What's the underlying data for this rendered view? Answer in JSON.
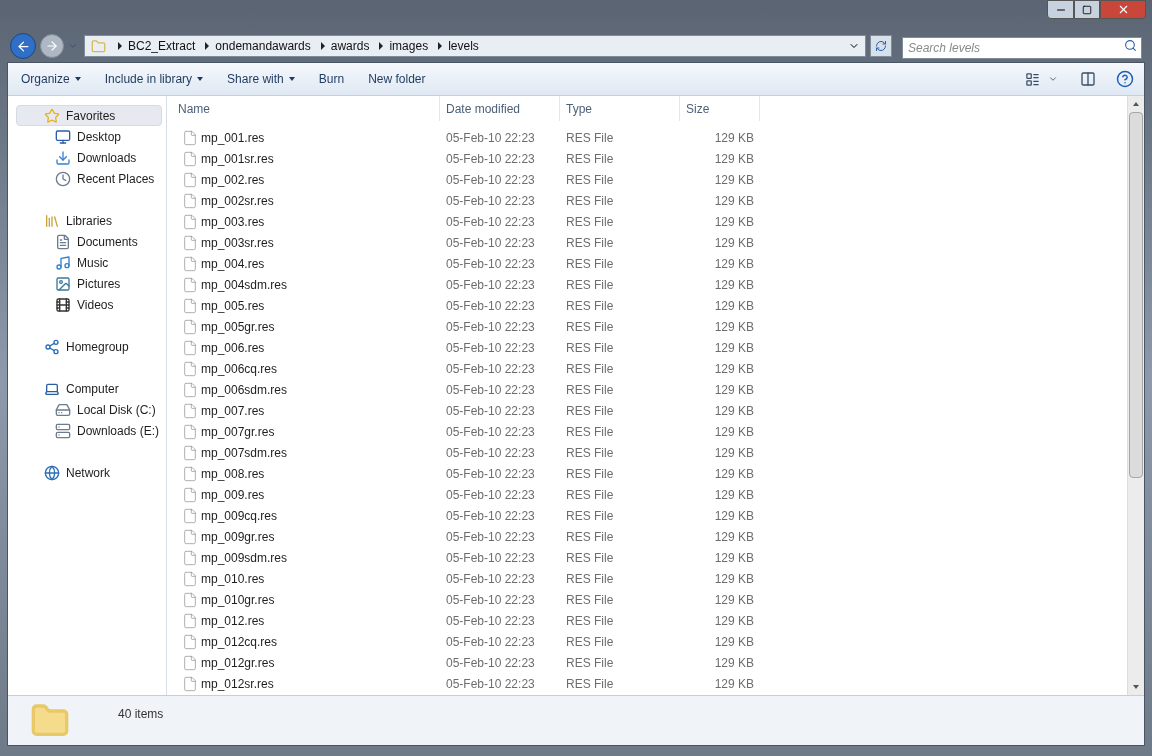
{
  "address": {
    "crumbs": [
      "BC2_Extract",
      "ondemandawards",
      "awards",
      "images",
      "levels"
    ]
  },
  "search": {
    "placeholder": "Search levels"
  },
  "toolbar": {
    "items": [
      {
        "label": "Organize",
        "dropdown": true
      },
      {
        "label": "Include in library",
        "dropdown": true
      },
      {
        "label": "Share with",
        "dropdown": true
      },
      {
        "label": "Burn",
        "dropdown": false
      },
      {
        "label": "New folder",
        "dropdown": false
      }
    ]
  },
  "sidebar": {
    "groups": [
      {
        "label": "Favorites",
        "selected": true,
        "children": [
          {
            "label": "Desktop",
            "selected": false
          },
          {
            "label": "Downloads",
            "selected": false
          },
          {
            "label": "Recent Places",
            "selected": false
          }
        ]
      },
      {
        "label": "Libraries",
        "selected": false,
        "children": [
          {
            "label": "Documents",
            "selected": false
          },
          {
            "label": "Music",
            "selected": false
          },
          {
            "label": "Pictures",
            "selected": false
          },
          {
            "label": "Videos",
            "selected": false
          }
        ]
      },
      {
        "label": "Homegroup",
        "selected": false
      },
      {
        "label": "Computer",
        "selected": false,
        "children": [
          {
            "label": "Local Disk (C:)",
            "selected": false
          },
          {
            "label": "Downloads (E:)",
            "selected": false
          }
        ]
      },
      {
        "label": "Network",
        "selected": false
      }
    ]
  },
  "table": {
    "columns": [
      "Name",
      "Date modified",
      "Type",
      "Size"
    ],
    "rows": [
      {
        "name": "mp_001.res",
        "date": "05-Feb-10 22:23",
        "type": "RES File",
        "size": "129 KB"
      },
      {
        "name": "mp_001sr.res",
        "date": "05-Feb-10 22:23",
        "type": "RES File",
        "size": "129 KB"
      },
      {
        "name": "mp_002.res",
        "date": "05-Feb-10 22:23",
        "type": "RES File",
        "size": "129 KB"
      },
      {
        "name": "mp_002sr.res",
        "date": "05-Feb-10 22:23",
        "type": "RES File",
        "size": "129 KB"
      },
      {
        "name": "mp_003.res",
        "date": "05-Feb-10 22:23",
        "type": "RES File",
        "size": "129 KB"
      },
      {
        "name": "mp_003sr.res",
        "date": "05-Feb-10 22:23",
        "type": "RES File",
        "size": "129 KB"
      },
      {
        "name": "mp_004.res",
        "date": "05-Feb-10 22:23",
        "type": "RES File",
        "size": "129 KB"
      },
      {
        "name": "mp_004sdm.res",
        "date": "05-Feb-10 22:23",
        "type": "RES File",
        "size": "129 KB"
      },
      {
        "name": "mp_005.res",
        "date": "05-Feb-10 22:23",
        "type": "RES File",
        "size": "129 KB"
      },
      {
        "name": "mp_005gr.res",
        "date": "05-Feb-10 22:23",
        "type": "RES File",
        "size": "129 KB"
      },
      {
        "name": "mp_006.res",
        "date": "05-Feb-10 22:23",
        "type": "RES File",
        "size": "129 KB"
      },
      {
        "name": "mp_006cq.res",
        "date": "05-Feb-10 22:23",
        "type": "RES File",
        "size": "129 KB"
      },
      {
        "name": "mp_006sdm.res",
        "date": "05-Feb-10 22:23",
        "type": "RES File",
        "size": "129 KB"
      },
      {
        "name": "mp_007.res",
        "date": "05-Feb-10 22:23",
        "type": "RES File",
        "size": "129 KB"
      },
      {
        "name": "mp_007gr.res",
        "date": "05-Feb-10 22:23",
        "type": "RES File",
        "size": "129 KB"
      },
      {
        "name": "mp_007sdm.res",
        "date": "05-Feb-10 22:23",
        "type": "RES File",
        "size": "129 KB"
      },
      {
        "name": "mp_008.res",
        "date": "05-Feb-10 22:23",
        "type": "RES File",
        "size": "129 KB"
      },
      {
        "name": "mp_009.res",
        "date": "05-Feb-10 22:23",
        "type": "RES File",
        "size": "129 KB"
      },
      {
        "name": "mp_009cq.res",
        "date": "05-Feb-10 22:23",
        "type": "RES File",
        "size": "129 KB"
      },
      {
        "name": "mp_009gr.res",
        "date": "05-Feb-10 22:23",
        "type": "RES File",
        "size": "129 KB"
      },
      {
        "name": "mp_009sdm.res",
        "date": "05-Feb-10 22:23",
        "type": "RES File",
        "size": "129 KB"
      },
      {
        "name": "mp_010.res",
        "date": "05-Feb-10 22:23",
        "type": "RES File",
        "size": "129 KB"
      },
      {
        "name": "mp_010gr.res",
        "date": "05-Feb-10 22:23",
        "type": "RES File",
        "size": "129 KB"
      },
      {
        "name": "mp_012.res",
        "date": "05-Feb-10 22:23",
        "type": "RES File",
        "size": "129 KB"
      },
      {
        "name": "mp_012cq.res",
        "date": "05-Feb-10 22:23",
        "type": "RES File",
        "size": "129 KB"
      },
      {
        "name": "mp_012gr.res",
        "date": "05-Feb-10 22:23",
        "type": "RES File",
        "size": "129 KB"
      },
      {
        "name": "mp_012sr.res",
        "date": "05-Feb-10 22:23",
        "type": "RES File",
        "size": "129 KB"
      }
    ]
  },
  "status_bar": {
    "count": "40 items"
  }
}
